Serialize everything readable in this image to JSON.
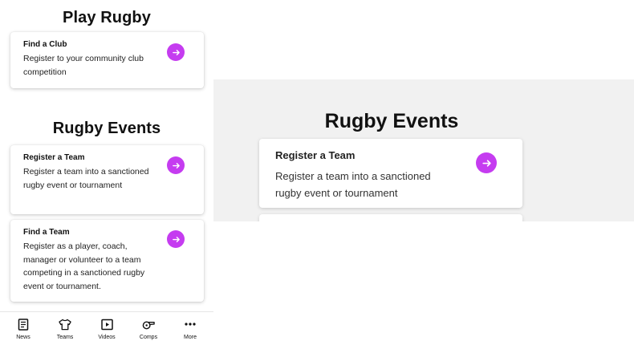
{
  "play_rugby": {
    "title": "Play Rugby",
    "cards": [
      {
        "title": "Find a Club",
        "description": "Register to your community club competition"
      }
    ]
  },
  "rugby_events": {
    "title": "Rugby Events",
    "cards": [
      {
        "title": "Register a Team",
        "description": "Register a team into a sanctioned rugby event or tournament"
      },
      {
        "title": "Find a Team",
        "description": "Register as a player, coach, manager or volunteer to a team competing in a sanctioned rugby event or tournament."
      }
    ]
  },
  "tabbar": {
    "items": [
      {
        "label": "News",
        "icon": "news-icon"
      },
      {
        "label": "Teams",
        "icon": "jersey-icon"
      },
      {
        "label": "Videos",
        "icon": "video-icon"
      },
      {
        "label": "Comps",
        "icon": "whistle-icon"
      },
      {
        "label": "More",
        "icon": "more-dots-icon"
      }
    ]
  },
  "zoom_panel": {
    "title": "Rugby Events",
    "card": {
      "title": "Register a Team",
      "description": "Register a team into a sanctioned rugby event or tournament"
    }
  },
  "colors": {
    "accent": "#c53cf0",
    "zoom_background": "#f1f1f1"
  }
}
